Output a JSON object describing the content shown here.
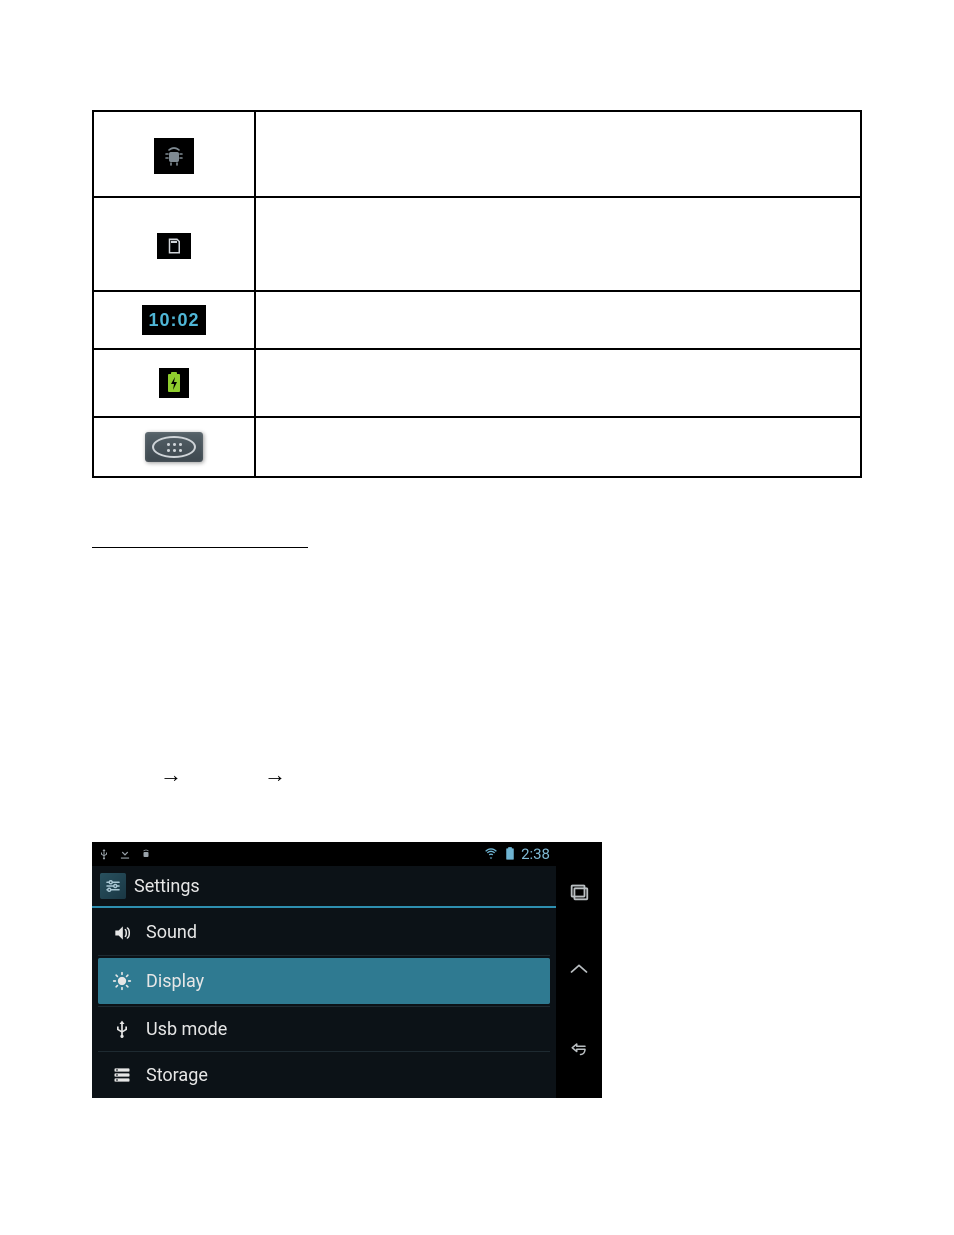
{
  "iconTable": {
    "clockTime": "10:02"
  },
  "arrows": {
    "a1": "→",
    "a2": "→"
  },
  "androidShot": {
    "statusTime": "2:38",
    "title": "Settings",
    "menu": [
      {
        "label": "Sound",
        "selected": false
      },
      {
        "label": "Display",
        "selected": true
      },
      {
        "label": "Usb mode",
        "selected": false
      },
      {
        "label": "Storage",
        "selected": false
      }
    ]
  }
}
